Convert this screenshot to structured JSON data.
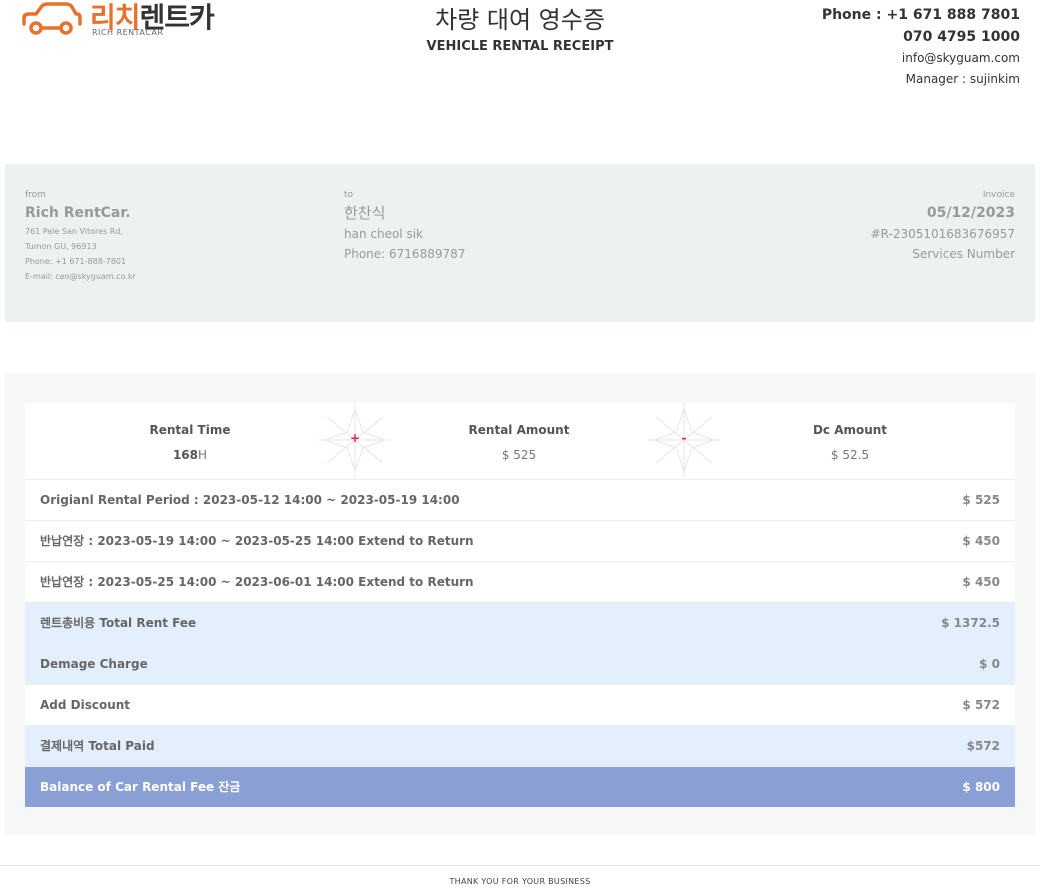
{
  "header": {
    "brand_ko_accent": "리치",
    "brand_ko_rest": "렌트카",
    "brand_en": "RICH RENTACAR",
    "title_ko": "차량 대여 영수증",
    "title_en": "VEHICLE RENTAL RECEIPT",
    "phone_1": "Phone : +1 671 888 7801",
    "phone_2": "070 4795 1000",
    "email": "info@skyguam.com",
    "manager": "Manager : sujinkim"
  },
  "colors": {
    "brand_orange": "#e8702a",
    "accent_pink": "#e91e63",
    "row_blue": "#e3effd",
    "final_blue": "#8aa0d4"
  },
  "info": {
    "from": {
      "label": "from",
      "name": "Rich RentCar.",
      "address_1": "761 Pale San Vitores Rd,",
      "address_2": "Tumon GU, 96913",
      "phone": "Phone: +1 671-888-7801",
      "email": "E-mail: ceo@skyguam.co.kr"
    },
    "to": {
      "label": "to",
      "name_ko": "한찬식",
      "name_en": "han cheol sik",
      "phone": "Phone: 6716889787"
    },
    "invoice": {
      "label": "Invoice",
      "date": "05/12/2023",
      "number": "#R-2305101683676957",
      "services": "Services Number"
    }
  },
  "stats": {
    "rental_time_label": "Rental Time",
    "rental_time_value": "168",
    "rental_time_unit": "H",
    "plus_symbol": "+",
    "rental_amount_label": "Rental Amount",
    "rental_amount_value": "$ 525",
    "minus_symbol": "-",
    "dc_amount_label": "Dc Amount",
    "dc_amount_value": "$ 52.5"
  },
  "rows": [
    {
      "label": "Origianl Rental Period : 2023-05-12 14:00 ~ 2023-05-19 14:00",
      "amount": "$ 525"
    },
    {
      "label": "반납연장 : 2023-05-19 14:00 ~ 2023-05-25 14:00 Extend to Return",
      "amount": "$ 450"
    },
    {
      "label": "반납연장 : 2023-05-25 14:00 ~ 2023-06-01 14:00 Extend to Return",
      "amount": "$ 450"
    },
    {
      "label": "렌트총비용 Total Rent Fee",
      "amount": "$ 1372.5"
    },
    {
      "label": "Demage Charge",
      "amount": "$ 0"
    },
    {
      "label": "Add Discount",
      "amount": "$ 572"
    },
    {
      "label": "결제내역 Total Paid",
      "amount": "$572"
    },
    {
      "label": "Balance of Car Rental Fee 잔금",
      "amount": "$ 800"
    }
  ],
  "footer": {
    "text": "THANK YOU FOR YOUR BUSINESS"
  }
}
